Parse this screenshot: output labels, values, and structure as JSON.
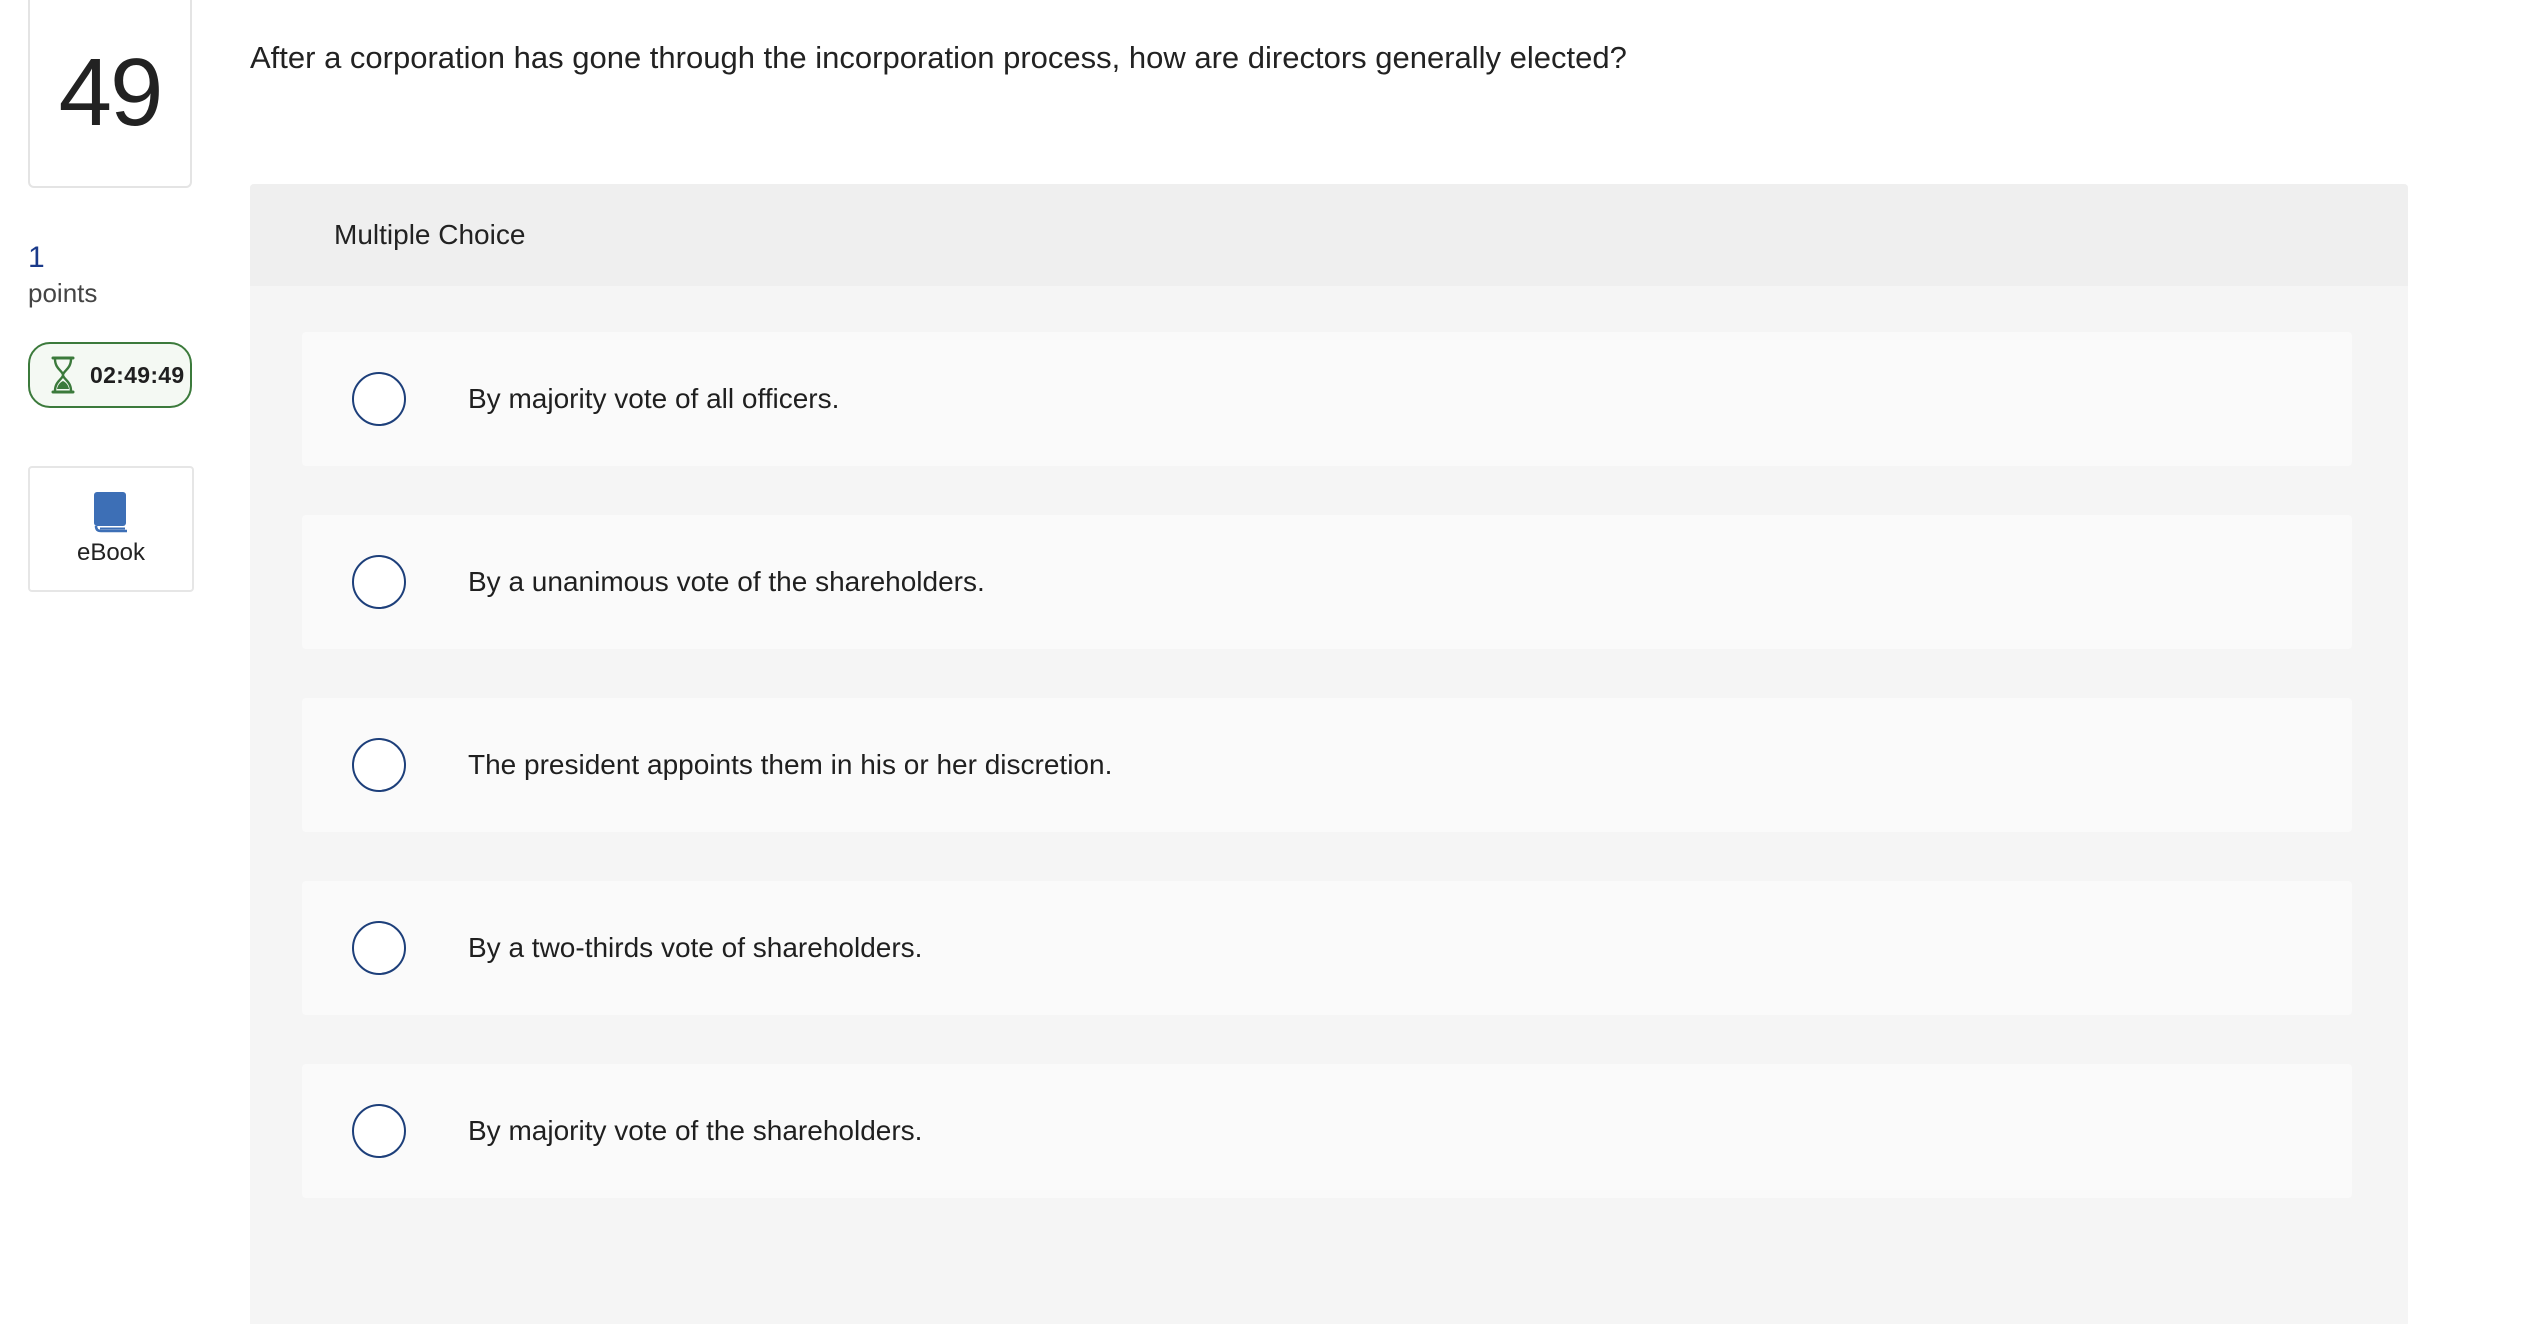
{
  "question": {
    "number": "49",
    "text": "After a corporation has gone through the incorporation process, how are directors generally elected?",
    "points_value": "1",
    "points_label": "points"
  },
  "timer": {
    "icon": "hourglass-icon",
    "time": "02:49:49",
    "color": "#3b7a3b"
  },
  "ebook": {
    "icon": "book-icon",
    "label": "eBook",
    "color": "#3d6fb6"
  },
  "multiple_choice": {
    "header": "Multiple Choice",
    "options": [
      {
        "label": "By majority vote of all officers.",
        "selected": false
      },
      {
        "label": "By a unanimous vote of the shareholders.",
        "selected": false
      },
      {
        "label": "The president appoints them in his or her discretion.",
        "selected": false
      },
      {
        "label": "By a two-thirds vote of shareholders.",
        "selected": false
      },
      {
        "label": "By majority vote of the shareholders.",
        "selected": false
      }
    ]
  }
}
